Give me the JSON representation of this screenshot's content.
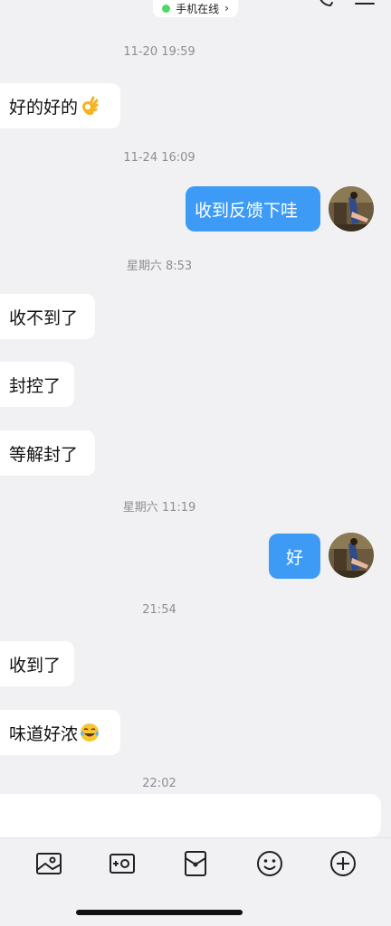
{
  "header": {
    "online_status": "手机在线",
    "online_color": "#4cd964",
    "chevron": "›"
  },
  "messages": {
    "t1": "11-20 19:59",
    "m1": "好的好的",
    "t2": "11-24 16:09",
    "m2": "收到反馈下哇",
    "t3": "星期六 8:53",
    "m3": "收不到了",
    "m4": "封控了",
    "m5": "等解封了",
    "t4": "星期六 11:19",
    "m6": "好",
    "t5": "21:54",
    "m7": "收到了",
    "m8": "味道好浓",
    "t6": "22:02"
  },
  "colors": {
    "outgoing_bubble": "#3d9bf5",
    "incoming_bubble": "#ffffff",
    "background": "#f1f1f3"
  },
  "icons": {
    "m1_emoji": "ok-hand-emoji",
    "m8_emoji": "tears-of-joy-emoji",
    "toolbar": [
      "image-icon",
      "camera-icon",
      "red-packet-icon",
      "emoji-icon",
      "plus-icon"
    ]
  }
}
